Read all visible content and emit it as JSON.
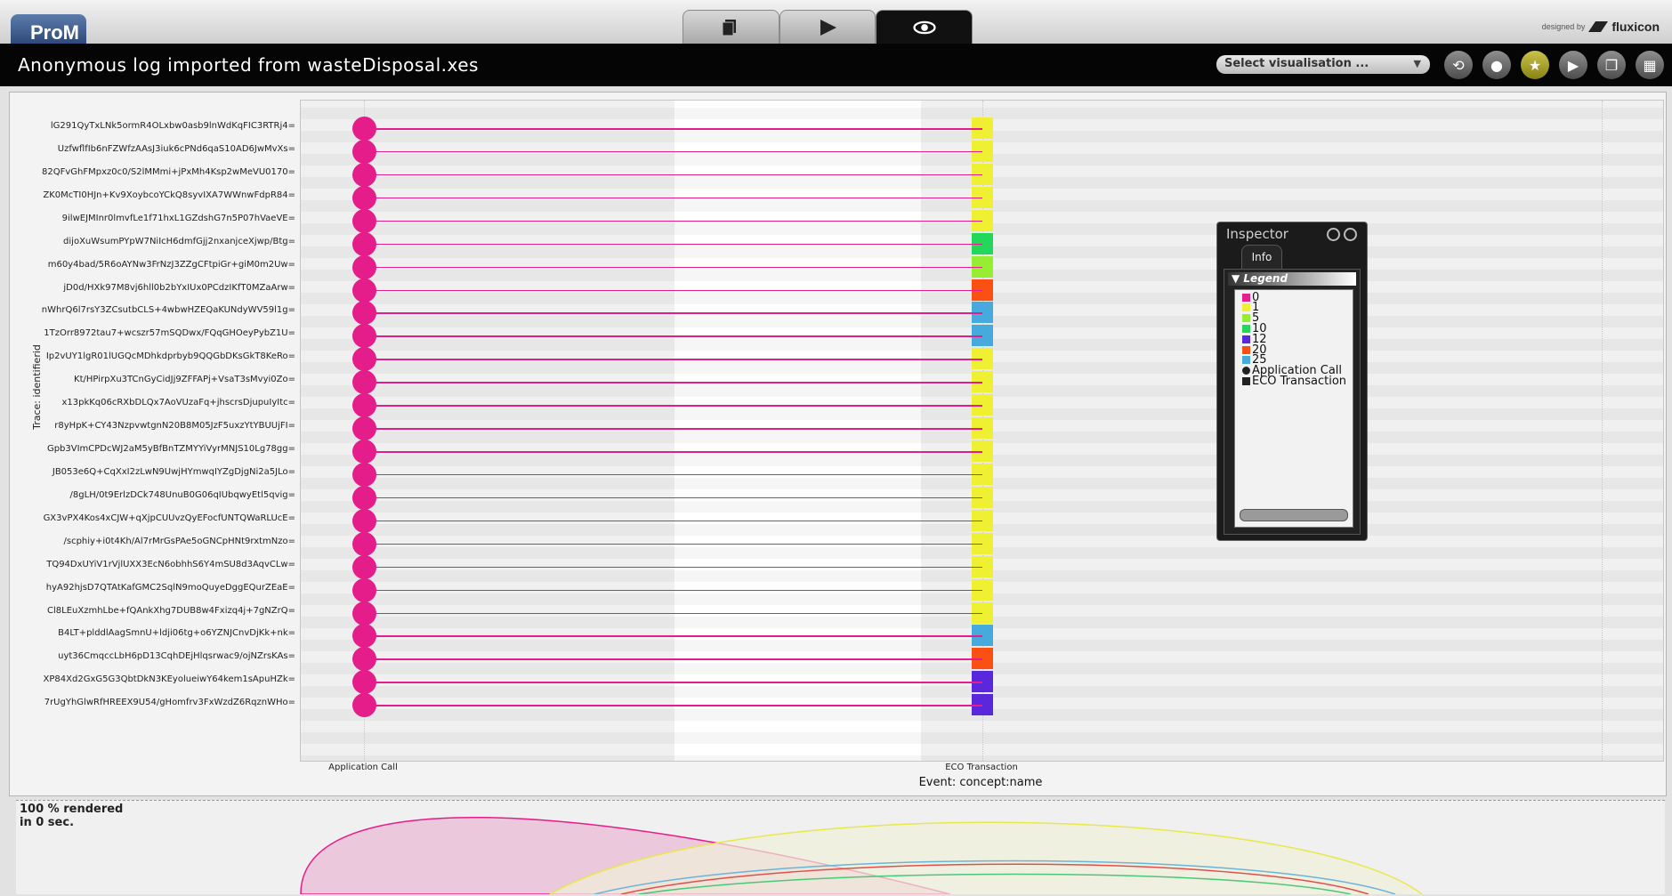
{
  "app": {
    "logo_text": "ProM",
    "designed_by": "designed by",
    "brand": "fluxicon",
    "mode_tabs": [
      {
        "icon": "copy-icon",
        "active": false
      },
      {
        "icon": "play-icon",
        "active": false
      },
      {
        "icon": "eye-icon",
        "active": true
      }
    ]
  },
  "titlebar": {
    "title": "Anonymous log imported from wasteDisposal.xes",
    "select_label": "Select visualisation ...",
    "select_arrow": "▼",
    "buttons": [
      {
        "icon": "refresh-icon",
        "glyph": "⟲"
      },
      {
        "icon": "drop-icon",
        "glyph": "●"
      },
      {
        "icon": "star-icon",
        "glyph": "★"
      },
      {
        "icon": "play-icon",
        "glyph": "▶"
      },
      {
        "icon": "copy-icon",
        "glyph": "❐"
      },
      {
        "icon": "grid-icon",
        "glyph": "▦"
      }
    ]
  },
  "plot": {
    "y_axis_label": "Trace: identifierid",
    "x_axis_label": "Event: concept:name",
    "x_categories": [
      "Application Call",
      "ECO Transaction"
    ],
    "traces": [
      {
        "id": "lG291QyTxLNk5ormR4OLxbw0asb9lnWdKqFIC3RTRj4=",
        "value": "1"
      },
      {
        "id": "UzfwflfIb6nFZWfzAAsJ3iuk6cPNd6qaS10AD6JwMvXs=",
        "value": "1"
      },
      {
        "id": "82QFvGhFMpxz0c0/S2lMMmi+jPxMh4Ksp2wMeVU0170=",
        "value": "1"
      },
      {
        "id": "ZK0McTI0HJn+Kv9XoybcoYCkQ8syvIXA7WWnwFdpR84=",
        "value": "1"
      },
      {
        "id": "9ilwEJMInr0lmvfLe1f71hxL1GZdshG7n5P07hVaeVE=",
        "value": "1"
      },
      {
        "id": "dijoXuWsumPYpW7NiIcH6dmfGjj2nxanjceXjwp/Btg=",
        "value": "10"
      },
      {
        "id": "m60y4bad/5R6oAYNw3FrNzJ3ZZgCFtpiGr+giM0m2Uw=",
        "value": "5"
      },
      {
        "id": "jD0d/HXk97M8vj6hll0b2bYxIUx0PCdzIKfT0MZaArw=",
        "value": "20"
      },
      {
        "id": "nWhrQ6l7rsY3ZCsutbCLS+4wbwHZEQaKUNdyWV59l1g=",
        "value": "25"
      },
      {
        "id": "1TzOrr8972tau7+wcszr57mSQDwx/FQqGHOeyPybZ1U=",
        "value": "25"
      },
      {
        "id": "Ip2vUY1lgR01lUGQcMDhkdprbyb9QQGbDKsGkT8KeRo=",
        "value": "1"
      },
      {
        "id": "Kt/HPirpXu3TCnGyCidJj9ZFFAPj+VsaT3sMvyi0Zo=",
        "value": "1"
      },
      {
        "id": "x13pkKq06cRXbDLQx7AoVUzaFq+jhscrsDjupuIyItc=",
        "value": "1"
      },
      {
        "id": "r8yHpK+CY43NzpvwtgnN20B8M05JzF5uxzYtYBUUjFI=",
        "value": "1"
      },
      {
        "id": "Gpb3VImCPDcWJ2aM5yBfBnTZMYYiVyrMNJS10Lg78gg=",
        "value": "1"
      },
      {
        "id": "JB053e6Q+CqXxI2zLwN9UwjHYmwqIYZgDjgNi2a5JLo=",
        "value": "1"
      },
      {
        "id": "/8gLH/0t9ErlzDCk748UnuB0G06qIUbqwyEtl5qvig=",
        "value": "1"
      },
      {
        "id": "GX3vPX4Kos4xCJW+qXjpCUUvzQyEFocfUNTQWaRLUcE=",
        "value": "1"
      },
      {
        "id": "/scphiy+i0t4Kh/Al7rMrGsPAe5oGNCpHNt9rxtmNzo=",
        "value": "1"
      },
      {
        "id": "TQ94DxUYiV1rVjlUXX3EcN6obhhS6Y4mSU8d3AqvCLw=",
        "value": "1"
      },
      {
        "id": "hyA92hjsD7QTAtKafGMC2SqlN9moQuyeDggEQurZEaE=",
        "value": "1"
      },
      {
        "id": "Cl8LEuXzmhLbe+fQAnkXhg7DUB8w4Fxizq4j+7gNZrQ=",
        "value": "1"
      },
      {
        "id": "B4LT+plddlAagSmnU+ldji06tg+o6YZNJCnvDjKk+nk=",
        "value": "25"
      },
      {
        "id": "uyt36CmqccLbH6pD13CqhDEjHlqsrwac9/ojNZrsKAs=",
        "value": "20"
      },
      {
        "id": "XP84Xd2GxG5G3QbtDkN3KEyolueiwY64kem1sApuHZk=",
        "value": "12"
      },
      {
        "id": "7rUgYhGlwRfHREEX9U54/gHomfrv3FxWzdZ6RqznWHo=",
        "value": "12"
      }
    ]
  },
  "status": {
    "line1": "100 % rendered",
    "line2": "in 0 sec."
  },
  "inspector": {
    "title": "Inspector",
    "tab": "Info",
    "legend_title": "▼ Legend",
    "legend": [
      {
        "label": "0",
        "color": "#e61e8c",
        "shape": "square"
      },
      {
        "label": "1",
        "color": "#f0f032",
        "shape": "square"
      },
      {
        "label": "5",
        "color": "#96ee32",
        "shape": "square"
      },
      {
        "label": "10",
        "color": "#22d75a",
        "shape": "square"
      },
      {
        "label": "12",
        "color": "#5a28dc",
        "shape": "square"
      },
      {
        "label": "20",
        "color": "#fa5014",
        "shape": "square"
      },
      {
        "label": "25",
        "color": "#46aadc",
        "shape": "square"
      },
      {
        "label": "Application Call",
        "color": "#222222",
        "shape": "circle"
      },
      {
        "label": "ECO Transaction",
        "color": "#222222",
        "shape": "square"
      }
    ]
  },
  "colors": {
    "dot": "#e51d8a",
    "1": "#f0f032",
    "5": "#96ee32",
    "10": "#22d75a",
    "12": "#5a28dc",
    "20": "#fa5014",
    "25": "#46aadc"
  }
}
